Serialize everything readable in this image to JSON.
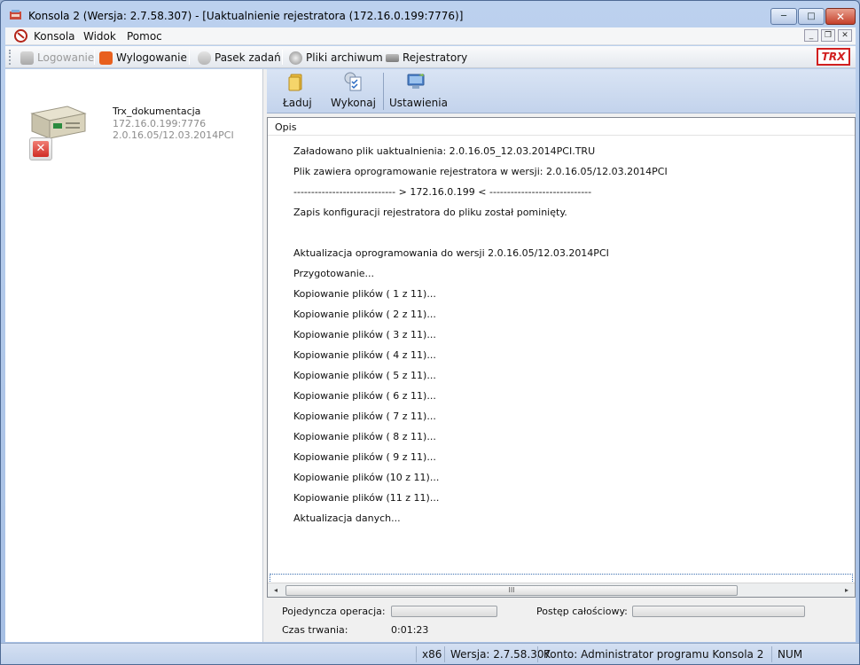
{
  "window": {
    "title": "Konsola 2 (Wersja:  2.7.58.307) - [Uaktualnienie rejestratora (172.16.0.199:7776)]",
    "controls": {
      "minimize": "─",
      "maximize": "□",
      "close": "✕"
    }
  },
  "menu": {
    "items": [
      "Konsola",
      "Widok",
      "Pomoc"
    ],
    "mdi": {
      "minimize": "_",
      "restore": "❐",
      "close": "✕"
    }
  },
  "toolbar": {
    "items": [
      {
        "label": "Logowanie",
        "icon": "key-icon",
        "enabled": false
      },
      {
        "label": "Wylogowanie",
        "icon": "power-icon",
        "enabled": true
      },
      {
        "label": "Pasek zadań",
        "icon": "paperclip-icon",
        "enabled": true
      },
      {
        "label": "Pliki archiwum",
        "icon": "globe-icon",
        "enabled": true
      },
      {
        "label": "Rejestratory",
        "icon": "recorder-icon",
        "enabled": true
      }
    ],
    "logo": "TRX"
  },
  "device": {
    "name": "Trx_dokumentacja",
    "address": "172.16.0.199:7776",
    "version": "2.0.16.05/12.03.2014PCI",
    "remove_icon": "✕"
  },
  "actions": {
    "load": "Ładuj",
    "execute": "Wykonaj",
    "settings": "Ustawienia"
  },
  "log": {
    "header": "Opis",
    "rows": [
      "Załadowano plik uaktualnienia: 2.0.16.05_12.03.2014PCI.TRU",
      "Plik zawiera oprogramowanie rejestratora w wersji: 2.0.16.05/12.03.2014PCI",
      "----------------------------- > 172.16.0.199 < -----------------------------",
      "Zapis konfiguracji rejestratora do pliku został pominięty.",
      "",
      "Aktualizacja oprogramowania do wersji 2.0.16.05/12.03.2014PCI",
      "Przygotowanie...",
      "Kopiowanie plików ( 1 z 11)...",
      "Kopiowanie plików ( 2 z 11)...",
      "Kopiowanie plików ( 3 z 11)...",
      "Kopiowanie plików ( 4 z 11)...",
      "Kopiowanie plików ( 5 z 11)...",
      "Kopiowanie plików ( 6 z 11)...",
      "Kopiowanie plików ( 7 z 11)...",
      "Kopiowanie plików ( 8 z 11)...",
      "Kopiowanie plików ( 9 z 11)...",
      "Kopiowanie plików (10 z 11)...",
      "Kopiowanie plików (11 z 11)...",
      "Aktualizacja danych..."
    ],
    "scroll_left": "◂",
    "scroll_right": "▸",
    "scroll_grip": "III"
  },
  "progress": {
    "single_label": "Pojedyncza operacja:",
    "single_value": 0,
    "total_label": "Postęp całościowy:",
    "total_value": 0,
    "time_label": "Czas trwania:",
    "time_value": "0:01:23"
  },
  "statusbar": {
    "arch": "x86",
    "version": "Wersja: 2.7.58.307",
    "account": "Konto: Administrator programu Konsola 2",
    "num": "NUM"
  }
}
